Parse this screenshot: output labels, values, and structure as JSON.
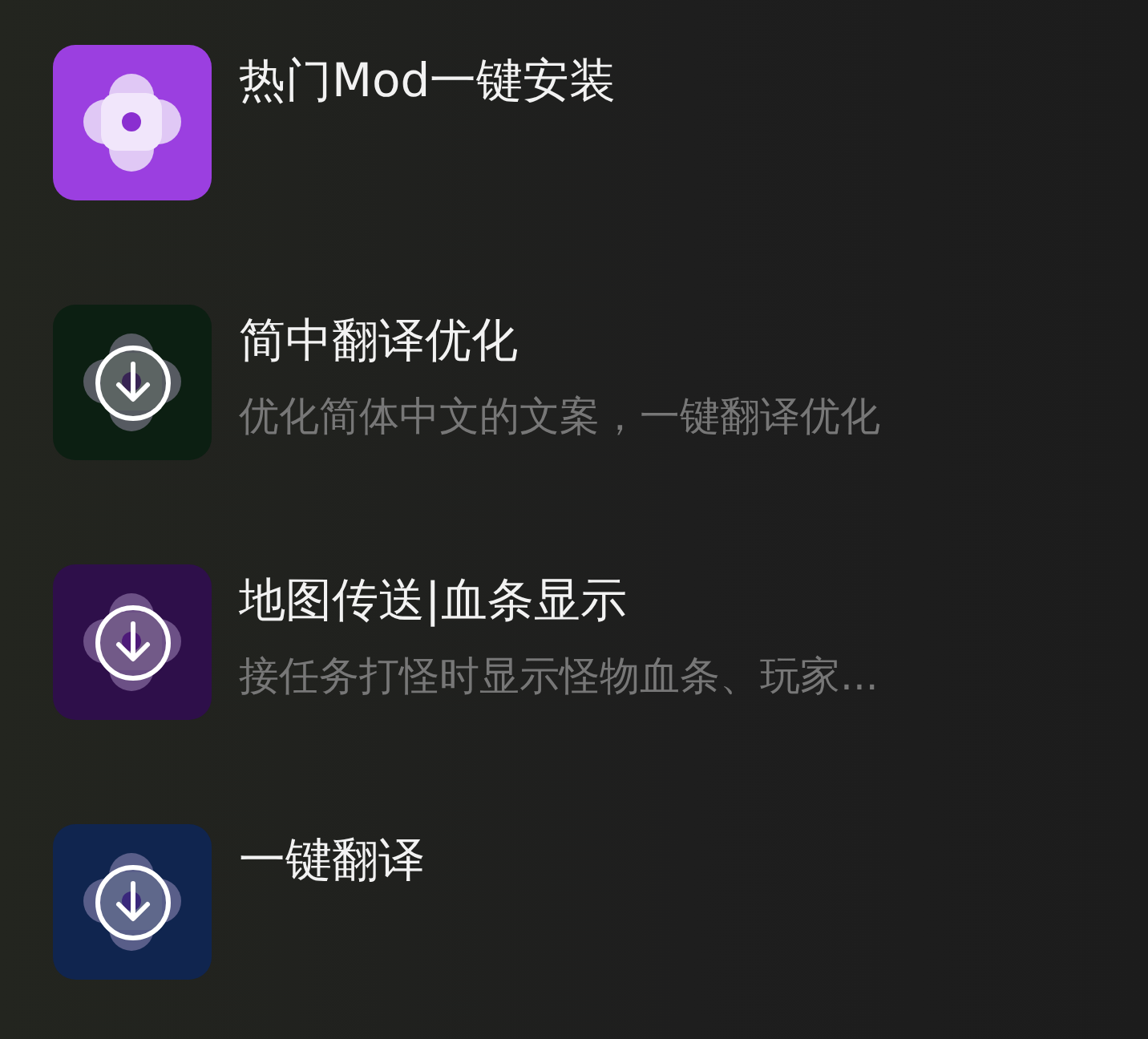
{
  "apps": [
    {
      "title": "热门Mod一键安装",
      "color": "#9b3fe0",
      "download": false
    },
    {
      "title": "简中翻译优化",
      "subtitle": "优化简体中文的文案，一键翻译优化",
      "color": "#0c1f12",
      "download": true
    },
    {
      "title": "地图传送|血条显示",
      "subtitle": "接任务打怪时显示怪物血条、玩家...",
      "color": "#2e0f4a",
      "download": true
    },
    {
      "title": "一键翻译",
      "color": "#10254f",
      "download": true
    }
  ]
}
